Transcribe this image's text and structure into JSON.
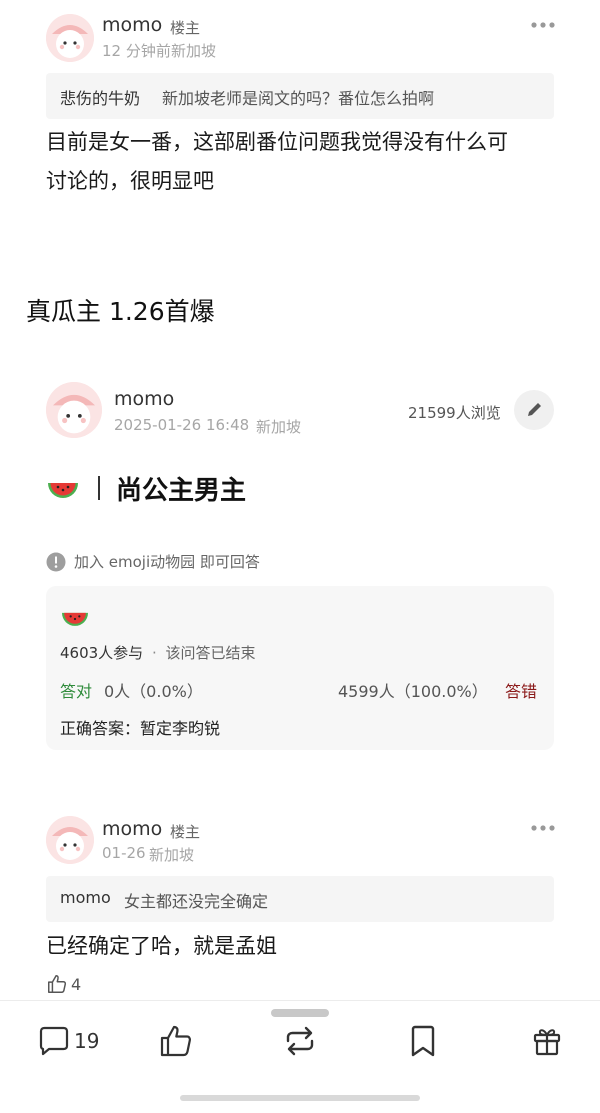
{
  "reply1": {
    "username": "momo",
    "owner_tag": "楼主",
    "time": "12 分钟前",
    "location": "新加坡",
    "quote_name": "悲伤的牛奶",
    "quote_text": "新加坡老师是阅文的吗？番位怎么拍啊",
    "body_line1": "目前是女一番，这部剧番位问题我觉得没有什么可",
    "body_line2": "讨论的，很明显吧"
  },
  "section_title": "真瓜主 1.26首爆",
  "post": {
    "username": "momo",
    "datetime": "2025-01-26 16:48",
    "location": "新加坡",
    "views": "21599人浏览",
    "title": "尚公主男主",
    "join_hint": "加入 emoji动物园 即可回答"
  },
  "poll": {
    "participants": "4603人参与",
    "separator": "·",
    "status": "该问答已结束",
    "correct_label": "答对",
    "correct_stats": "0人（0.0%）",
    "wrong_stats": "4599人（100.0%）",
    "wrong_label": "答错",
    "answer_label": "正确答案：",
    "answer_value": "暂定李昀锐",
    "colors": {
      "correct": "#2e8b3a",
      "wrong": "#8b1a1a"
    }
  },
  "reply2": {
    "username": "momo",
    "owner_tag": "楼主",
    "time": "01-26",
    "location": "新加坡",
    "quote_name": "momo",
    "quote_text": "女主都还没完全确定",
    "body": "已经确定了哈，就是孟姐",
    "likes": "4"
  },
  "tabbar": {
    "comment_count": "19",
    "icons": [
      "comment-icon",
      "thumbs-up-icon",
      "repost-icon",
      "bookmark-icon",
      "gift-icon"
    ]
  }
}
